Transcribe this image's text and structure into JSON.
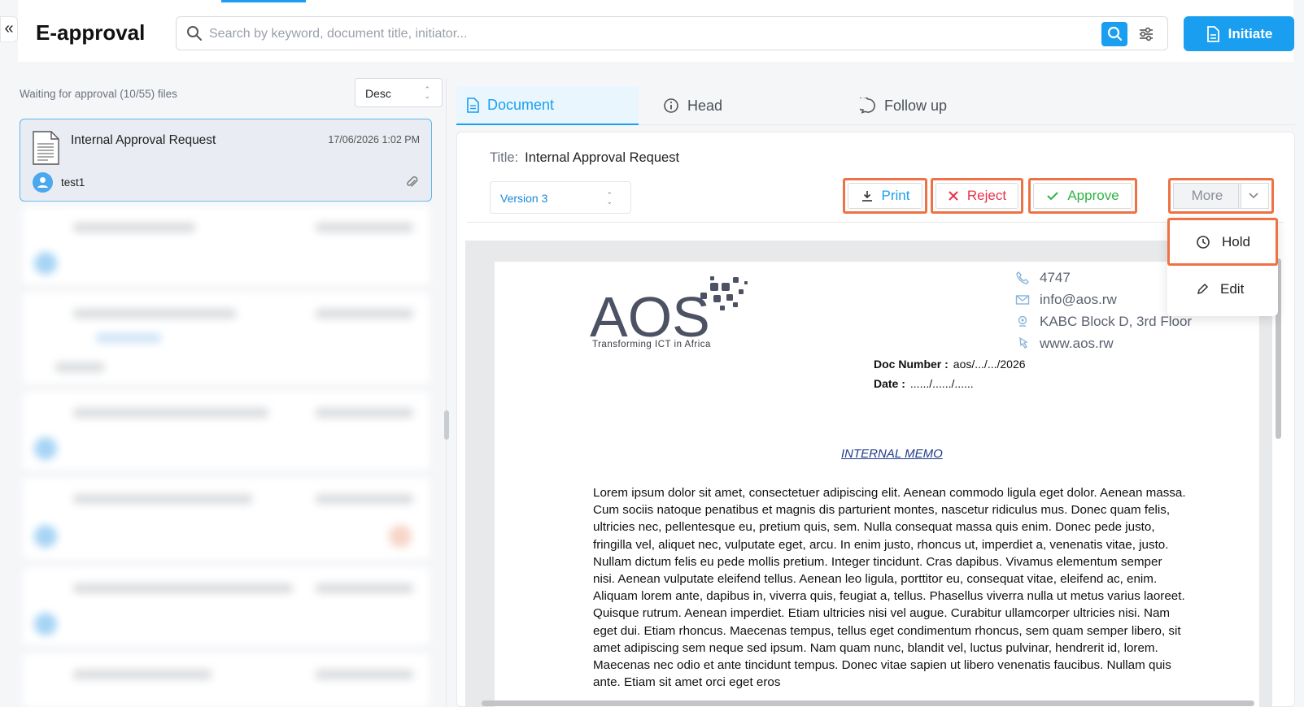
{
  "app": {
    "title": "E-approval",
    "collapse_glyph": "«"
  },
  "search": {
    "placeholder": "Search by keyword, document title, initiator...",
    "value": ""
  },
  "header": {
    "initiate_label": "Initiate",
    "accent_color": "#1a9ff0"
  },
  "list": {
    "waiting_label": "Waiting for approval (10/55) files",
    "sort": {
      "selected": "Desc"
    },
    "selected_file": {
      "title": "Internal Approval Request",
      "date": "17/06/2026 1:02 PM",
      "user": "test1"
    }
  },
  "tabs": [
    {
      "label": "Document",
      "icon": "document-icon",
      "active": true
    },
    {
      "label": "Head",
      "icon": "info-icon",
      "active": false
    },
    {
      "label": "Follow up",
      "icon": "chat-icon",
      "active": false
    }
  ],
  "document": {
    "title_key": "Title:",
    "title_value": "Internal Approval Request",
    "version": "Version 3"
  },
  "actions": {
    "print": "Print",
    "reject": "Reject",
    "approve": "Approve",
    "more": "More",
    "hold": "Hold",
    "edit": "Edit",
    "colors": {
      "print": "#1a9ff0",
      "reject": "#e8344b",
      "approve": "#2fb344",
      "highlight": "#ee7244"
    }
  },
  "memo": {
    "logo_text": "AOS",
    "logo_tagline": "Transforming ICT in Africa",
    "contacts": [
      {
        "icon": "phone-icon",
        "text": "4747"
      },
      {
        "icon": "mail-icon",
        "text": "info@aos.rw"
      },
      {
        "icon": "location-icon",
        "text": "KABC Block D, 3rd Floor"
      },
      {
        "icon": "web-icon",
        "text": "www.aos.rw"
      }
    ],
    "doc_number_label": "Doc  Number  :",
    "doc_number_value": "aos/.../.../2026",
    "date_label": "Date  :",
    "date_value": "....../....../......",
    "heading": "INTERNAL MEMO",
    "body": "Lorem ipsum dolor sit amet, consectetuer adipiscing elit. Aenean commodo ligula eget dolor. Aenean massa. Cum sociis natoque penatibus et magnis dis parturient montes, nascetur ridiculus mus. Donec quam felis, ultricies nec, pellentesque eu, pretium quis, sem. Nulla consequat massa quis enim. Donec pede justo, fringilla vel, aliquet nec, vulputate eget, arcu. In enim justo, rhoncus ut, imperdiet a, venenatis vitae, justo. Nullam dictum felis eu pede mollis pretium. Integer tincidunt. Cras dapibus. Vivamus elementum semper nisi. Aenean vulputate eleifend tellus. Aenean leo ligula, porttitor eu, consequat vitae, eleifend ac, enim. Aliquam lorem ante, dapibus in, viverra quis, feugiat a, tellus. Phasellus viverra nulla ut metus varius laoreet. Quisque rutrum. Aenean imperdiet. Etiam ultricies nisi vel augue. Curabitur ullamcorper ultricies nisi. Nam eget dui. Etiam rhoncus. Maecenas tempus, tellus eget condimentum rhoncus, sem quam semper libero, sit amet adipiscing sem neque sed ipsum. Nam quam nunc, blandit vel, luctus pulvinar, hendrerit id, lorem. Maecenas nec odio et ante tincidunt tempus. Donec vitae sapien ut libero venenatis faucibus. Nullam quis ante. Etiam sit amet orci eget eros"
  }
}
